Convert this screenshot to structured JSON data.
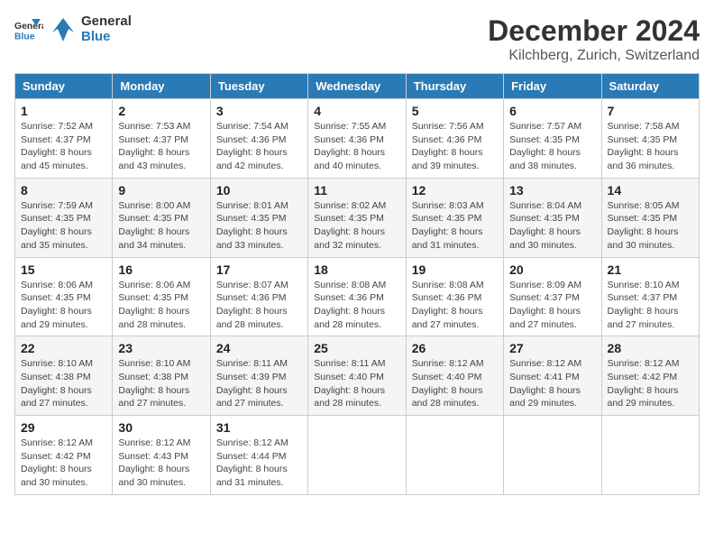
{
  "logo": {
    "general": "General",
    "blue": "Blue"
  },
  "title": "December 2024",
  "location": "Kilchberg, Zurich, Switzerland",
  "days_of_week": [
    "Sunday",
    "Monday",
    "Tuesday",
    "Wednesday",
    "Thursday",
    "Friday",
    "Saturday"
  ],
  "weeks": [
    [
      {
        "day": "1",
        "sunrise": "7:52 AM",
        "sunset": "4:37 PM",
        "daylight": "8 hours and 45 minutes."
      },
      {
        "day": "2",
        "sunrise": "7:53 AM",
        "sunset": "4:37 PM",
        "daylight": "8 hours and 43 minutes."
      },
      {
        "day": "3",
        "sunrise": "7:54 AM",
        "sunset": "4:36 PM",
        "daylight": "8 hours and 42 minutes."
      },
      {
        "day": "4",
        "sunrise": "7:55 AM",
        "sunset": "4:36 PM",
        "daylight": "8 hours and 40 minutes."
      },
      {
        "day": "5",
        "sunrise": "7:56 AM",
        "sunset": "4:36 PM",
        "daylight": "8 hours and 39 minutes."
      },
      {
        "day": "6",
        "sunrise": "7:57 AM",
        "sunset": "4:35 PM",
        "daylight": "8 hours and 38 minutes."
      },
      {
        "day": "7",
        "sunrise": "7:58 AM",
        "sunset": "4:35 PM",
        "daylight": "8 hours and 36 minutes."
      }
    ],
    [
      {
        "day": "8",
        "sunrise": "7:59 AM",
        "sunset": "4:35 PM",
        "daylight": "8 hours and 35 minutes."
      },
      {
        "day": "9",
        "sunrise": "8:00 AM",
        "sunset": "4:35 PM",
        "daylight": "8 hours and 34 minutes."
      },
      {
        "day": "10",
        "sunrise": "8:01 AM",
        "sunset": "4:35 PM",
        "daylight": "8 hours and 33 minutes."
      },
      {
        "day": "11",
        "sunrise": "8:02 AM",
        "sunset": "4:35 PM",
        "daylight": "8 hours and 32 minutes."
      },
      {
        "day": "12",
        "sunrise": "8:03 AM",
        "sunset": "4:35 PM",
        "daylight": "8 hours and 31 minutes."
      },
      {
        "day": "13",
        "sunrise": "8:04 AM",
        "sunset": "4:35 PM",
        "daylight": "8 hours and 30 minutes."
      },
      {
        "day": "14",
        "sunrise": "8:05 AM",
        "sunset": "4:35 PM",
        "daylight": "8 hours and 30 minutes."
      }
    ],
    [
      {
        "day": "15",
        "sunrise": "8:06 AM",
        "sunset": "4:35 PM",
        "daylight": "8 hours and 29 minutes."
      },
      {
        "day": "16",
        "sunrise": "8:06 AM",
        "sunset": "4:35 PM",
        "daylight": "8 hours and 28 minutes."
      },
      {
        "day": "17",
        "sunrise": "8:07 AM",
        "sunset": "4:36 PM",
        "daylight": "8 hours and 28 minutes."
      },
      {
        "day": "18",
        "sunrise": "8:08 AM",
        "sunset": "4:36 PM",
        "daylight": "8 hours and 28 minutes."
      },
      {
        "day": "19",
        "sunrise": "8:08 AM",
        "sunset": "4:36 PM",
        "daylight": "8 hours and 27 minutes."
      },
      {
        "day": "20",
        "sunrise": "8:09 AM",
        "sunset": "4:37 PM",
        "daylight": "8 hours and 27 minutes."
      },
      {
        "day": "21",
        "sunrise": "8:10 AM",
        "sunset": "4:37 PM",
        "daylight": "8 hours and 27 minutes."
      }
    ],
    [
      {
        "day": "22",
        "sunrise": "8:10 AM",
        "sunset": "4:38 PM",
        "daylight": "8 hours and 27 minutes."
      },
      {
        "day": "23",
        "sunrise": "8:10 AM",
        "sunset": "4:38 PM",
        "daylight": "8 hours and 27 minutes."
      },
      {
        "day": "24",
        "sunrise": "8:11 AM",
        "sunset": "4:39 PM",
        "daylight": "8 hours and 27 minutes."
      },
      {
        "day": "25",
        "sunrise": "8:11 AM",
        "sunset": "4:40 PM",
        "daylight": "8 hours and 28 minutes."
      },
      {
        "day": "26",
        "sunrise": "8:12 AM",
        "sunset": "4:40 PM",
        "daylight": "8 hours and 28 minutes."
      },
      {
        "day": "27",
        "sunrise": "8:12 AM",
        "sunset": "4:41 PM",
        "daylight": "8 hours and 29 minutes."
      },
      {
        "day": "28",
        "sunrise": "8:12 AM",
        "sunset": "4:42 PM",
        "daylight": "8 hours and 29 minutes."
      }
    ],
    [
      {
        "day": "29",
        "sunrise": "8:12 AM",
        "sunset": "4:42 PM",
        "daylight": "8 hours and 30 minutes."
      },
      {
        "day": "30",
        "sunrise": "8:12 AM",
        "sunset": "4:43 PM",
        "daylight": "8 hours and 30 minutes."
      },
      {
        "day": "31",
        "sunrise": "8:12 AM",
        "sunset": "4:44 PM",
        "daylight": "8 hours and 31 minutes."
      },
      null,
      null,
      null,
      null
    ]
  ],
  "labels": {
    "sunrise": "Sunrise:",
    "sunset": "Sunset:",
    "daylight": "Daylight:"
  }
}
